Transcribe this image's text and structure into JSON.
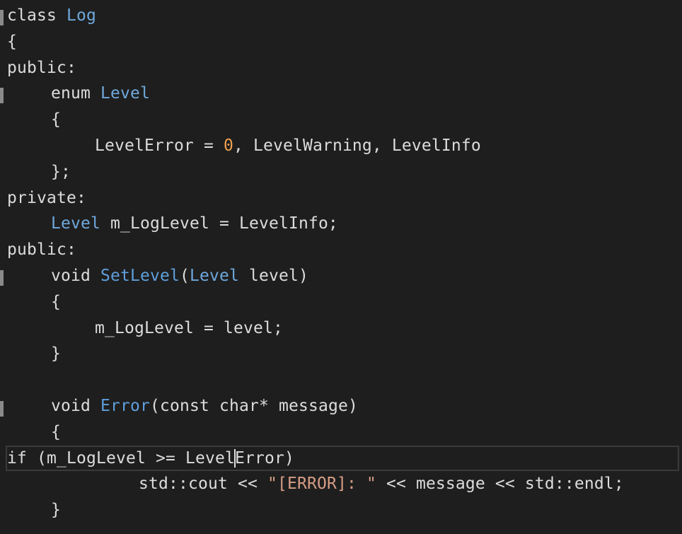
{
  "editor": {
    "lines": [
      {
        "indent": 0,
        "tokens": [
          {
            "t": "class",
            "c": "kw-plain"
          },
          {
            "t": " ",
            "c": "ident"
          },
          {
            "t": "Log",
            "c": "enum-type"
          }
        ]
      },
      {
        "indent": 0,
        "tokens": [
          {
            "t": "{",
            "c": "ident"
          }
        ]
      },
      {
        "indent": 0,
        "tokens": [
          {
            "t": "public:",
            "c": "kw-plain"
          }
        ]
      },
      {
        "indent": 1,
        "tokens": [
          {
            "t": "enum",
            "c": "kw-plain"
          },
          {
            "t": " ",
            "c": "ident"
          },
          {
            "t": "Level",
            "c": "enum-type"
          }
        ]
      },
      {
        "indent": 1,
        "tokens": [
          {
            "t": "{",
            "c": "ident"
          }
        ]
      },
      {
        "indent": 2,
        "tokens": [
          {
            "t": "LevelError = ",
            "c": "ident"
          },
          {
            "t": "0",
            "c": "num"
          },
          {
            "t": ", LevelWarning, LevelInfo",
            "c": "ident"
          }
        ]
      },
      {
        "indent": 1,
        "tokens": [
          {
            "t": "};",
            "c": "ident"
          }
        ]
      },
      {
        "indent": 0,
        "tokens": [
          {
            "t": "private:",
            "c": "kw-plain"
          }
        ]
      },
      {
        "indent": 1,
        "tokens": [
          {
            "t": "Level",
            "c": "enum-type"
          },
          {
            "t": " m_LogLevel = LevelInfo;",
            "c": "ident"
          }
        ]
      },
      {
        "indent": 0,
        "tokens": [
          {
            "t": "public:",
            "c": "kw-plain"
          }
        ]
      },
      {
        "indent": 1,
        "tokens": [
          {
            "t": "void",
            "c": "kw-plain"
          },
          {
            "t": " ",
            "c": "ident"
          },
          {
            "t": "SetLevel",
            "c": "fn"
          },
          {
            "t": "(",
            "c": "ident"
          },
          {
            "t": "Level",
            "c": "enum-type"
          },
          {
            "t": " level)",
            "c": "ident"
          }
        ]
      },
      {
        "indent": 1,
        "tokens": [
          {
            "t": "{",
            "c": "ident"
          }
        ]
      },
      {
        "indent": 2,
        "tokens": [
          {
            "t": "m_LogLevel = level;",
            "c": "ident"
          }
        ]
      },
      {
        "indent": 1,
        "tokens": [
          {
            "t": "}",
            "c": "ident"
          }
        ]
      },
      {
        "indent": 0,
        "tokens": [
          {
            "t": "",
            "c": "ident"
          }
        ]
      },
      {
        "indent": 1,
        "tokens": [
          {
            "t": "void",
            "c": "kw-plain"
          },
          {
            "t": " ",
            "c": "ident"
          },
          {
            "t": "Error",
            "c": "fn"
          },
          {
            "t": "(const char* message)",
            "c": "ident"
          }
        ]
      },
      {
        "indent": 1,
        "tokens": [
          {
            "t": "{",
            "c": "ident"
          }
        ]
      },
      {
        "indent": 2,
        "current": true,
        "tokens": [
          {
            "t": "if",
            "c": "kw-plain"
          },
          {
            "t": " (m_LogLevel >= Level",
            "c": "ident"
          },
          {
            "t": "|cursor|",
            "c": "cursor"
          },
          {
            "t": "Error)",
            "c": "ident"
          }
        ]
      },
      {
        "indent": 3,
        "tokens": [
          {
            "t": "std::cout << ",
            "c": "ident"
          },
          {
            "t": "\"[ERROR]: \"",
            "c": "str"
          },
          {
            "t": " << message << std::endl;",
            "c": "ident"
          }
        ]
      },
      {
        "indent": 1,
        "tokens": [
          {
            "t": "}",
            "c": "ident"
          }
        ]
      }
    ]
  }
}
